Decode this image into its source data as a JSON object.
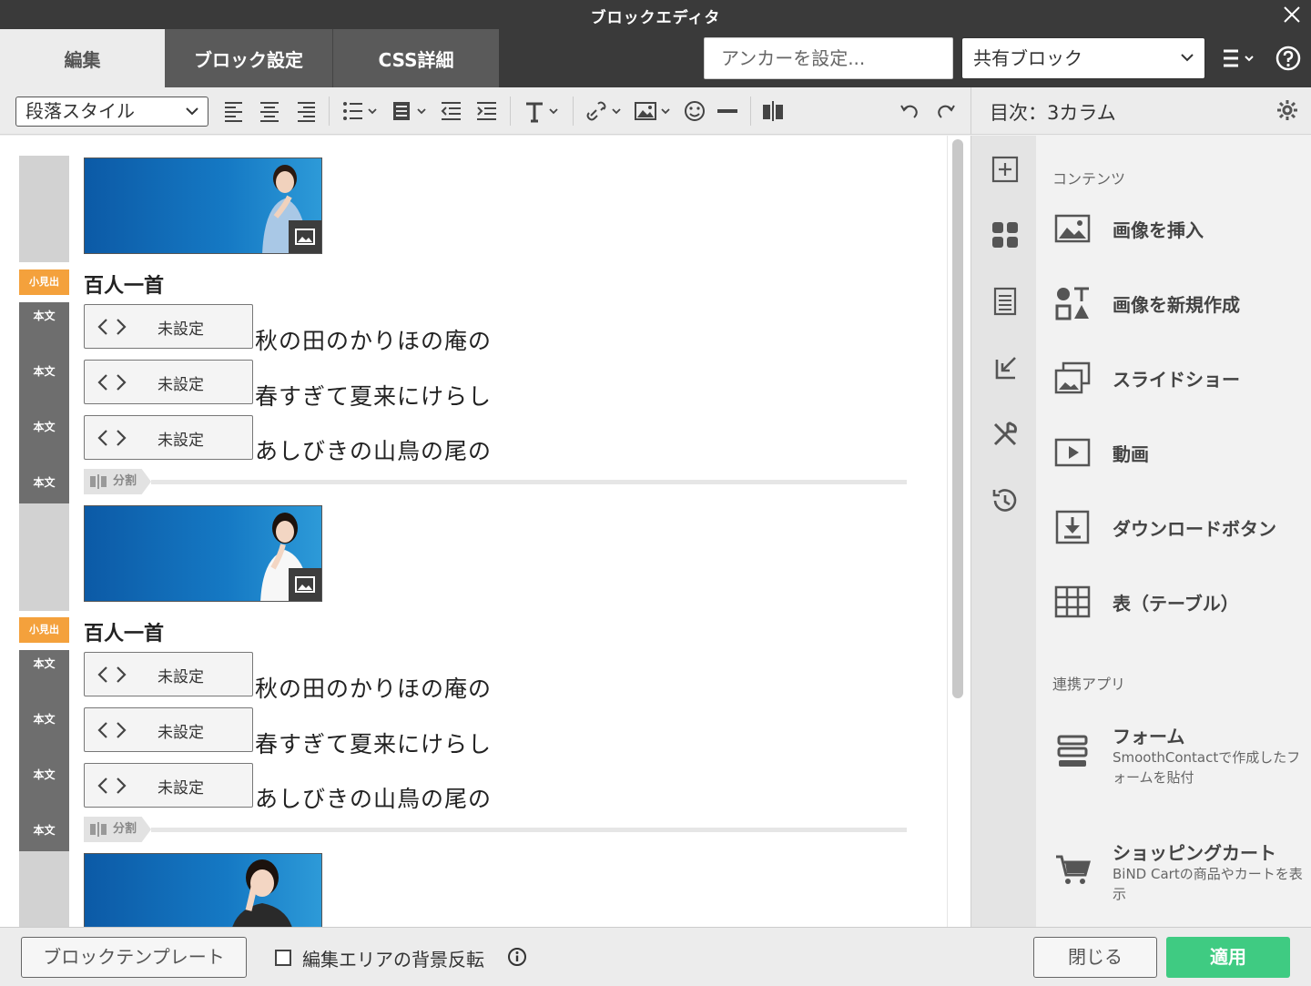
{
  "window": {
    "title": "ブロックエディタ"
  },
  "tabs": [
    {
      "label": "編集",
      "active": true
    },
    {
      "label": "ブロック設定",
      "active": false
    },
    {
      "label": "CSS詳細",
      "active": false
    }
  ],
  "anchor": {
    "placeholder": "アンカーを設定..."
  },
  "shared_block": {
    "selected": "共有ブロック"
  },
  "toolbar": {
    "paragraph_style": "段落スタイル",
    "icons": [
      "align-left-icon",
      "align-center-icon",
      "align-right-icon",
      "bullet-list-icon",
      "block-format-icon",
      "outdent-icon",
      "indent-icon",
      "text-style-icon",
      "link-icon",
      "image-icon",
      "emoji-icon",
      "horizontal-rule-icon",
      "column-split-icon",
      "undo-icon",
      "redo-icon"
    ]
  },
  "toc": {
    "title": "目次：3カラム"
  },
  "editor": {
    "blocks": [
      {
        "heading_badge": "小見出",
        "heading": "百人一首",
        "body_badge": "本文",
        "rows": [
          {
            "code_label": "未設定",
            "text": "秋の田のかりほの庵の"
          },
          {
            "code_label": "未設定",
            "text": "春すぎて夏来にけらし"
          },
          {
            "code_label": "未設定",
            "text": "あしびきの山鳥の尾の"
          }
        ],
        "body_badge_4": "本文",
        "divider_label": "分割"
      },
      {
        "heading_badge": "小見出",
        "heading": "百人一首",
        "body_badge": "本文",
        "rows": [
          {
            "code_label": "未設定",
            "text": "秋の田のかりほの庵の"
          },
          {
            "code_label": "未設定",
            "text": "春すぎて夏来にけらし"
          },
          {
            "code_label": "未設定",
            "text": "あしびきの山鳥の尾の"
          }
        ],
        "body_badge_4": "本文",
        "divider_label": "分割"
      }
    ]
  },
  "sidebar": {
    "section_contents": "コンテンツ",
    "items": [
      {
        "label": "画像を挿入",
        "icon": "insert-image-icon"
      },
      {
        "label": "画像を新規作成",
        "icon": "create-image-icon"
      },
      {
        "label": "スライドショー",
        "icon": "slideshow-icon"
      },
      {
        "label": "動画",
        "icon": "video-icon"
      },
      {
        "label": "ダウンロードボタン",
        "icon": "download-icon"
      },
      {
        "label": "表（テーブル）",
        "icon": "table-icon"
      }
    ],
    "section_apps": "連携アプリ",
    "apps": [
      {
        "label": "フォーム",
        "desc": "SmoothContactで作成したフォームを貼付",
        "icon": "form-icon"
      },
      {
        "label": "ショッピングカート",
        "desc": "BiND Cartの商品やカートを表示",
        "icon": "cart-icon"
      }
    ],
    "rail_icons": [
      "add-block-icon",
      "blocks-icon",
      "page-icon",
      "import-icon",
      "tools-icon",
      "history-icon"
    ]
  },
  "footer": {
    "template_button": "ブロックテンプレート",
    "invert_label": "編集エリアの背景反転",
    "invert_checked": false,
    "close_button": "閉じる",
    "apply_button": "適用"
  },
  "colors": {
    "accent_orange": "#f4a13c",
    "apply_green": "#3fcb82",
    "titlebar": "#3a3a3a"
  }
}
